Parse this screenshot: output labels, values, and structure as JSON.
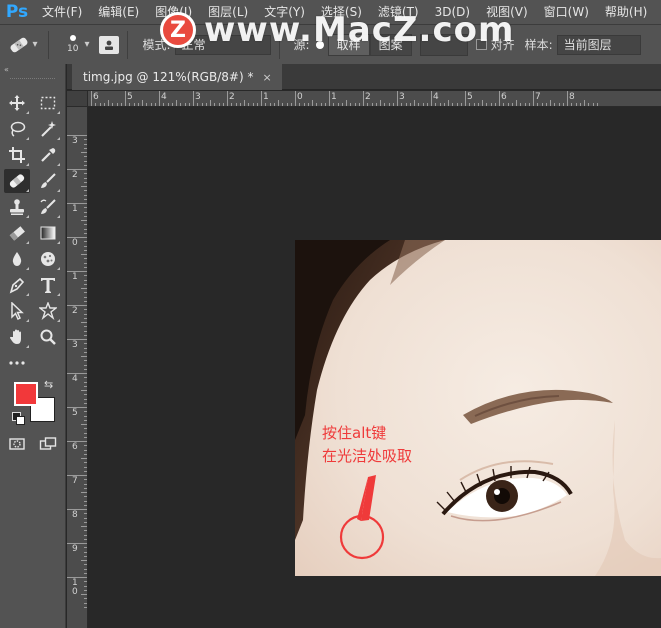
{
  "app": {
    "logo": "Ps"
  },
  "menu": [
    "文件(F)",
    "编辑(E)",
    "图像(I)",
    "图层(L)",
    "文字(Y)",
    "选择(S)",
    "滤镜(T)",
    "3D(D)",
    "视图(V)",
    "窗口(W)",
    "帮助(H)"
  ],
  "watermark": {
    "badge": "Z",
    "text": "www.MacZ.com"
  },
  "options": {
    "brush_size": "10",
    "mode_label": "模式:",
    "mode_value": "正常",
    "source_label": "源:",
    "source_sample": "取样",
    "source_pattern": "图案",
    "aligned_label": "对齐",
    "sample_label": "样本:",
    "sample_value": "当前图层"
  },
  "document": {
    "tab_title": "timg.jpg @ 121%(RGB/8#) *",
    "close_glyph": "×"
  },
  "rulers": {
    "horizontal": [
      "6",
      "5",
      "4",
      "3",
      "2",
      "1",
      "0",
      "1",
      "2",
      "3",
      "4",
      "5",
      "6",
      "7",
      "8"
    ],
    "vertical": [
      "3",
      "2",
      "1",
      "0",
      "1",
      "2",
      "3",
      "4",
      "5",
      "6",
      "7",
      "8",
      "9",
      "10"
    ]
  },
  "annotation": {
    "line1": "按住alt键",
    "line2": "在光洁处吸取",
    "color": "#ef3a3a"
  },
  "colors": {
    "foreground": "#f2383a",
    "background": "#ffffff",
    "ps_blue": "#31a8ff"
  },
  "tools": [
    "move-tool",
    "marquee-tool",
    "lasso-tool",
    "magic-wand-tool",
    "crop-tool",
    "eyedropper-tool",
    "spot-healing-brush-tool",
    "brush-tool",
    "clone-stamp-tool",
    "history-brush-tool",
    "eraser-tool",
    "gradient-tool",
    "blur-tool",
    "sponge-tool",
    "pen-tool",
    "type-tool",
    "path-selection-tool",
    "custom-shape-tool",
    "hand-tool",
    "zoom-tool",
    "edit-toolbar",
    "quick-mask",
    "screen-mode"
  ]
}
